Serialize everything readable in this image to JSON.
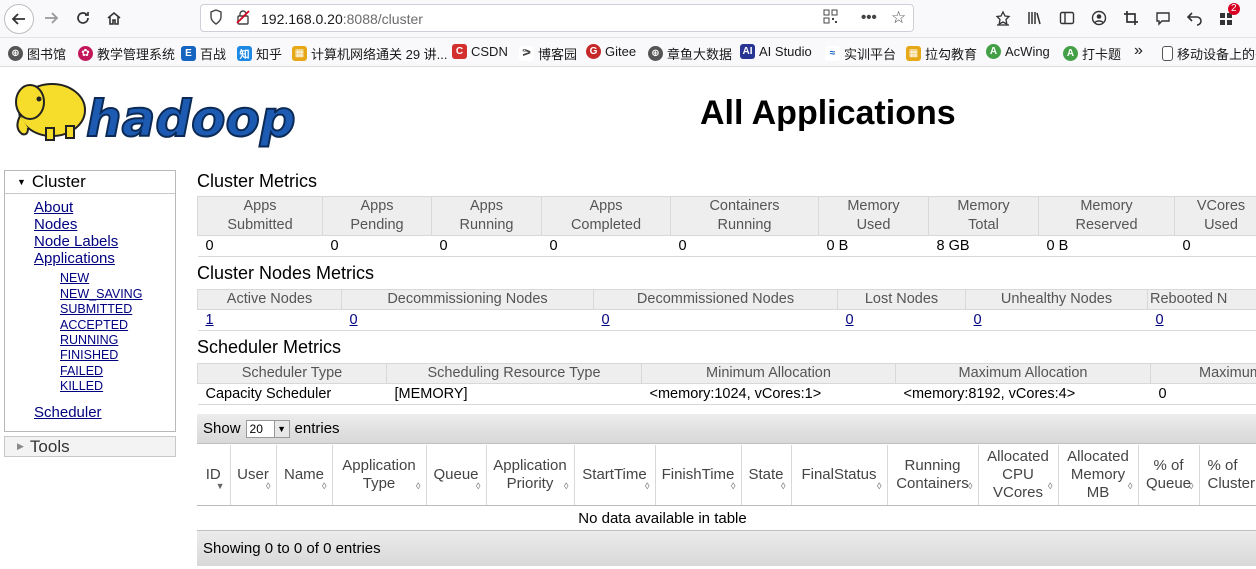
{
  "browser": {
    "url_host": "192.168.0.20",
    "url_rest": ":8088/cluster",
    "notification_count": "2"
  },
  "bookmarks": [
    {
      "label": "图书馆",
      "color": "#555555",
      "icon": "globe-icon"
    },
    {
      "label": "教学管理系统",
      "color": "#c2185b",
      "icon": "flower-icon"
    },
    {
      "label": "百战",
      "color": "#1565c0",
      "icon": "e-icon"
    },
    {
      "label": "知乎",
      "color": "#1e88e5",
      "icon": "zhihu-icon"
    },
    {
      "label": "计算机网络通关 29 讲...",
      "color": "#e6a817",
      "icon": "grid-icon"
    },
    {
      "label": "CSDN",
      "color": "#d32f2f",
      "icon": "csdn-icon"
    },
    {
      "label": "博客园",
      "color": "#444444",
      "icon": "cnblogs-icon"
    },
    {
      "label": "Gitee",
      "color": "#c62828",
      "icon": "gitee-icon"
    },
    {
      "label": "章鱼大数据",
      "color": "#555555",
      "icon": "globe-icon"
    },
    {
      "label": "AI Studio",
      "color": "#283593",
      "icon": "ai-icon"
    },
    {
      "label": "实训平台",
      "color": "#1565c0",
      "icon": "wave-icon"
    },
    {
      "label": "拉勾教育",
      "color": "#e6a817",
      "icon": "grid-icon"
    },
    {
      "label": "AcWing",
      "color": "#43a047",
      "icon": "acwing-icon"
    },
    {
      "label": "打卡题",
      "color": "#43a047",
      "icon": "acwing-icon"
    },
    {
      "label": "移动设备上的书",
      "color": "#555555",
      "icon": "device-icon"
    }
  ],
  "page": {
    "title": "All Applications",
    "logo_text": "hadoop"
  },
  "sidebar": {
    "cluster_label": "Cluster",
    "links": [
      "About",
      "Nodes",
      "Node Labels",
      "Applications"
    ],
    "app_states": [
      "NEW",
      "NEW_SAVING",
      "SUBMITTED",
      "ACCEPTED",
      "RUNNING",
      "FINISHED",
      "FAILED",
      "KILLED"
    ],
    "scheduler_label": "Scheduler",
    "tools_label": "Tools"
  },
  "cluster_metrics": {
    "title": "Cluster Metrics",
    "headers": [
      [
        "Apps",
        "Submitted"
      ],
      [
        "Apps",
        "Pending"
      ],
      [
        "Apps",
        "Running"
      ],
      [
        "Apps",
        "Completed"
      ],
      [
        "Containers",
        "Running"
      ],
      [
        "Memory",
        "Used"
      ],
      [
        "Memory",
        "Total"
      ],
      [
        "Memory",
        "Reserved"
      ],
      [
        "VCores",
        "Used"
      ]
    ],
    "values": [
      "0",
      "0",
      "0",
      "0",
      "0",
      "0 B",
      "8 GB",
      "0 B",
      "0"
    ]
  },
  "nodes_metrics": {
    "title": "Cluster Nodes Metrics",
    "headers": [
      "Active Nodes",
      "Decommissioning Nodes",
      "Decommissioned Nodes",
      "Lost Nodes",
      "Unhealthy Nodes",
      "Rebooted N"
    ],
    "values": [
      "1",
      "0",
      "0",
      "0",
      "0",
      "0"
    ]
  },
  "scheduler_metrics": {
    "title": "Scheduler Metrics",
    "headers": [
      "Scheduler Type",
      "Scheduling Resource Type",
      "Minimum Allocation",
      "Maximum Allocation",
      "Maximum"
    ],
    "values": [
      "Capacity Scheduler",
      "[MEMORY]",
      "<memory:1024, vCores:1>",
      "<memory:8192, vCores:4>",
      "0"
    ]
  },
  "datatable": {
    "show_label": "Show",
    "page_size": "20",
    "entries_label": "entries",
    "columns": [
      [
        "ID"
      ],
      [
        "User"
      ],
      [
        "Name"
      ],
      [
        "Application",
        "Type"
      ],
      [
        "Queue"
      ],
      [
        "Application",
        "Priority"
      ],
      [
        "StartTime"
      ],
      [
        "FinishTime"
      ],
      [
        "State"
      ],
      [
        "FinalStatus"
      ],
      [
        "Running",
        "Containers"
      ],
      [
        "Allocated",
        "CPU",
        "VCores"
      ],
      [
        "Allocated",
        "Memory",
        "MB"
      ],
      [
        "% of",
        "Queue"
      ],
      [
        "% of",
        "Cluster"
      ]
    ],
    "empty_message": "No data available in table",
    "footer": "Showing 0 to 0 of 0 entries"
  }
}
